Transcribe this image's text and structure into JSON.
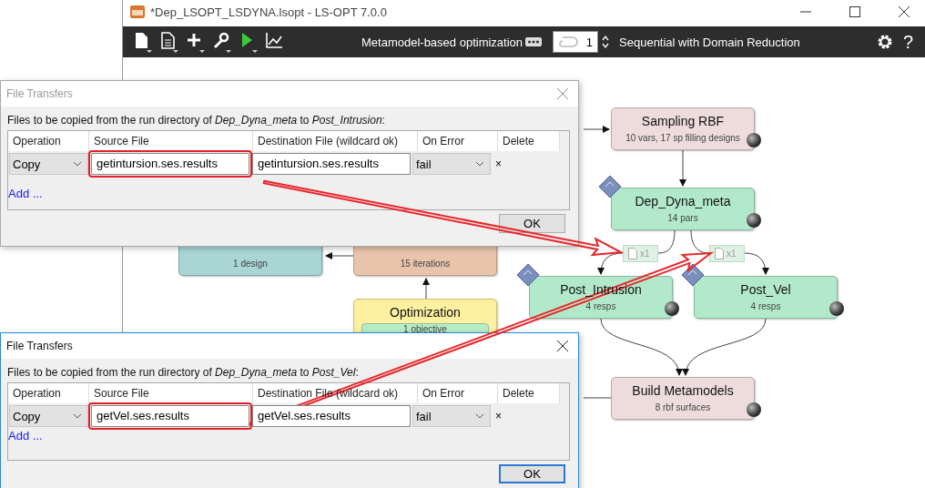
{
  "window": {
    "title": "*Dep_LSOPT_LSDYNA.lsopt - LS-OPT 7.0.0"
  },
  "toolbar": {
    "mode": "Metamodel-based optimization",
    "iterations": "1",
    "strategy": "Sequential with Domain Reduction",
    "help": "?"
  },
  "nodes": [
    {
      "kind": "sampling",
      "title": "Sampling RBF",
      "subtitle": "10 vars, 17 sp filling designs"
    },
    {
      "kind": "stage",
      "title": "Dep_Dyna_meta",
      "subtitle": "14 pars"
    },
    {
      "kind": "stage",
      "title": "Post_Intrusion",
      "subtitle": "4 resps"
    },
    {
      "kind": "stage",
      "title": "Post_Vel",
      "subtitle": "4 resps"
    },
    {
      "kind": "metamodel",
      "title": "Build Metamodels",
      "subtitle": "8 rbf surfaces"
    },
    {
      "kind": "verification",
      "subtitle": "1 design"
    },
    {
      "kind": "termination",
      "subtitle": "15 iterations"
    },
    {
      "kind": "optimization",
      "title": "Optimization",
      "subtitle": "1 objective"
    }
  ],
  "transfer_chips": [
    {
      "label": "x1"
    },
    {
      "label": "x1"
    }
  ],
  "dialogs": [
    {
      "title": "File Transfers",
      "active": false,
      "intro": "Files to be copied from the run directory of *Dep_Dyna_meta* to *Post_Intrusion*:",
      "columns": [
        "Operation",
        "Source File",
        "Destination File (wildcard ok)",
        "On Error",
        "Delete"
      ],
      "rows": [
        {
          "operation": "Copy",
          "source": "getintursion.ses.results",
          "source_highlighted": true,
          "destination": "getintursion.ses.results",
          "on_error": "fail",
          "delete": "×"
        }
      ],
      "add_link": "Add ...",
      "ok": "OK"
    },
    {
      "title": "File Transfers",
      "active": true,
      "intro": "Files to be copied from the run directory of *Dep_Dyna_meta* to *Post_Vel*:",
      "columns": [
        "Operation",
        "Source File",
        "Destination File (wildcard ok)",
        "On Error",
        "Delete"
      ],
      "rows": [
        {
          "operation": "Copy",
          "source": "getVel.ses.results",
          "source_highlighted": true,
          "destination": "getVel.ses.results",
          "on_error": "fail",
          "delete": "×"
        }
      ],
      "add_link": "Add ...",
      "ok": "OK"
    }
  ]
}
